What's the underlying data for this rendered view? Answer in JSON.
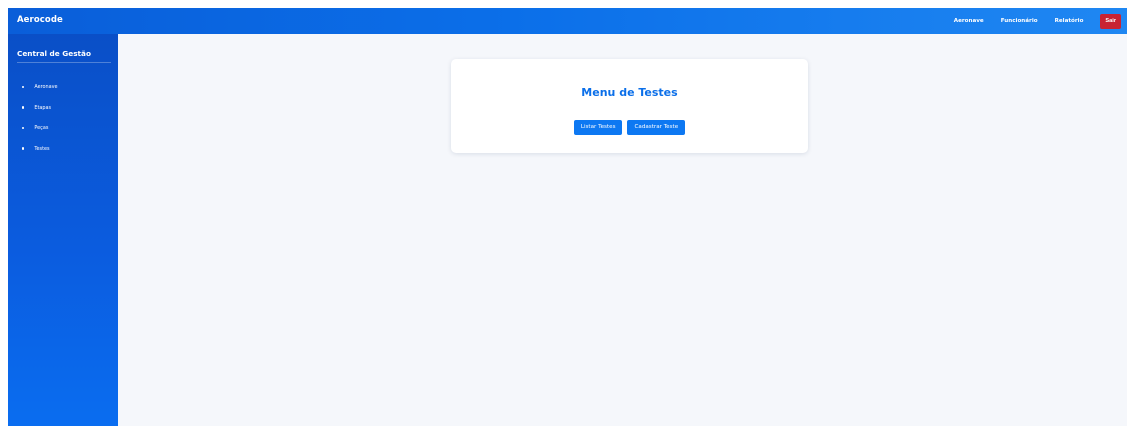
{
  "app": {
    "brand": "Aerocode"
  },
  "header": {
    "nav": [
      "Aeronave",
      "Funcionário",
      "Relatório"
    ],
    "logout_label": "Sair"
  },
  "sidebar": {
    "title": "Central de Gestão",
    "items": [
      {
        "label": "Aeronave"
      },
      {
        "label": "Etapas"
      },
      {
        "label": "Peças"
      },
      {
        "label": "Testes"
      }
    ]
  },
  "main": {
    "card_title": "Menu de Testes",
    "buttons": [
      {
        "label": "Listar Testes"
      },
      {
        "label": "Cadastrar Teste"
      }
    ]
  },
  "colors": {
    "primary": "#0b6fe9",
    "danger": "#c82333",
    "background": "#f5f7fb"
  }
}
